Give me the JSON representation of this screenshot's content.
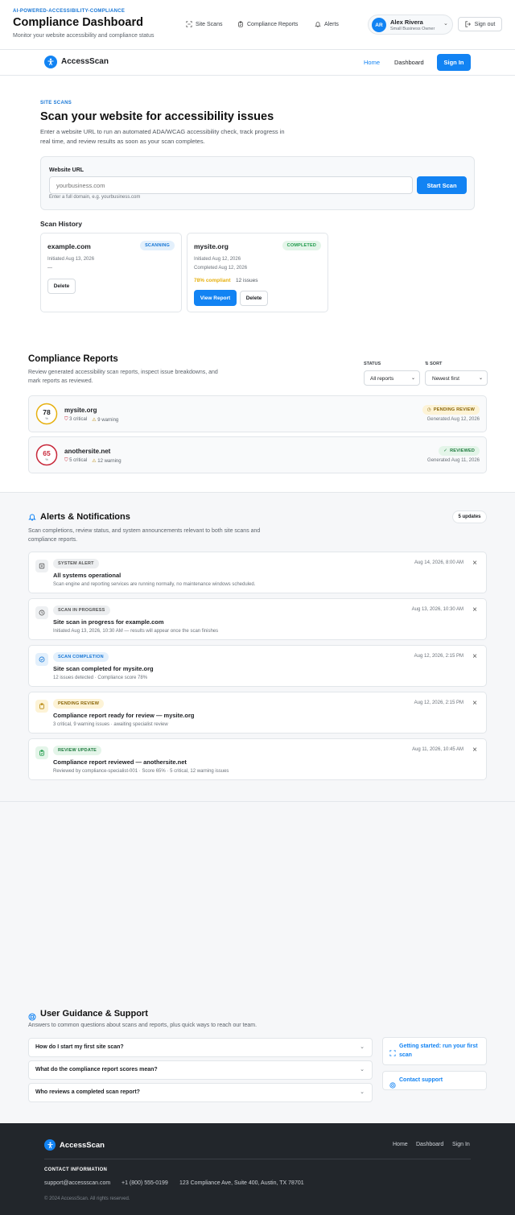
{
  "header": {
    "eyebrow": "AI-POWERED-ACCESSIBILITY-COMPLIANCE",
    "title": "Compliance Dashboard",
    "subtitle": "Monitor your website accessibility and compliance status",
    "tabs": [
      {
        "label": "Site Scans",
        "icon": "scan-icon"
      },
      {
        "label": "Compliance Reports",
        "icon": "clipboard-icon"
      },
      {
        "label": "Alerts",
        "icon": "bell-icon"
      }
    ],
    "user": {
      "initials": "AR",
      "name": "Alex Rivera",
      "role": "Small Business Owner"
    },
    "signout": "Sign out"
  },
  "sitenav": {
    "brand": "AccessScan",
    "links": [
      "Home",
      "Dashboard"
    ],
    "signin": "Sign In"
  },
  "scan": {
    "eyebrow": "SITE SCANS",
    "title": "Scan your website for accessibility issues",
    "desc": "Enter a website URL to run an automated ADA/WCAG accessibility check, track progress in real time, and review results as soon as your scan completes.",
    "url_label": "Website URL",
    "url_placeholder": "yourbusiness.com",
    "url_hint": "Enter a full domain, e.g. yourbusiness.com",
    "start_button": "Start Scan",
    "history_title": "Scan History",
    "history": [
      {
        "domain": "example.com",
        "status": "SCANNING",
        "initiated": "Initiated Aug 13, 2026",
        "extra": "—",
        "delete": "Delete"
      },
      {
        "domain": "mysite.org",
        "status": "COMPLETED",
        "initiated": "Initiated Aug 12, 2026",
        "completed": "Completed Aug 12, 2026",
        "compliant": "78% compliant",
        "issues": "12 issues",
        "view": "View Report",
        "delete": "Delete"
      }
    ]
  },
  "reports": {
    "title": "Compliance Reports",
    "desc": "Review generated accessibility scan reports, inspect issue breakdowns, and mark reports as reviewed.",
    "status_label": "STATUS",
    "sort_label": "SORT",
    "status_value": "All reports",
    "sort_value": "Newest first",
    "items": [
      {
        "score": "78",
        "unit": "%",
        "domain": "mysite.org",
        "critical": "3 critical",
        "warning": "9 warning",
        "badge": "PENDING REVIEW",
        "generated": "Generated Aug 12, 2026",
        "ring_color": "#e6b00f",
        "score_fraction": 0.78
      },
      {
        "score": "65",
        "unit": "%",
        "domain": "anothersite.net",
        "critical": "5 critical",
        "warning": "12 warning",
        "badge": "REVIEWED",
        "generated": "Generated Aug 11, 2026",
        "ring_color": "#c8283a",
        "score_fraction": 0.65
      }
    ]
  },
  "alerts": {
    "title": "Alerts & Notifications",
    "desc": "Scan completions, review status, and system announcements relevant to both site scans and compliance reports.",
    "count": "5 updates",
    "items": [
      {
        "tag": "SYSTEM ALERT",
        "title": "All systems operational",
        "sub": "Scan engine and reporting services are running normally, no maintenance windows scheduled.",
        "time": "Aug 14, 2026, 8:00 AM",
        "icon": "server-icon"
      },
      {
        "tag": "SCAN IN PROGRESS",
        "title": "Site scan in progress for example.com",
        "sub": "Initiated Aug 13, 2026, 10:30 AM — results will appear once the scan finishes",
        "time": "Aug 13, 2026, 10:30 AM",
        "icon": "clock-icon"
      },
      {
        "tag": "SCAN COMPLETION",
        "title": "Site scan completed for mysite.org",
        "sub": "12 issues detected · Compliance score 78%",
        "time": "Aug 12, 2026, 2:15 PM",
        "icon": "check-circle-icon"
      },
      {
        "tag": "PENDING REVIEW",
        "title": "Compliance report ready for review — mysite.org",
        "sub": "3 critical, 9 warning issues · awaiting specialist review",
        "time": "Aug 12, 2026, 2:15 PM",
        "icon": "clipboard-icon"
      },
      {
        "tag": "REVIEW UPDATE",
        "title": "Compliance report reviewed — anothersite.net",
        "sub": "Reviewed by compliance-specialist-001 · Score 65% · 5 critical, 12 warning issues",
        "time": "Aug 11, 2026, 10:45 AM",
        "icon": "clipboard-check-icon"
      }
    ]
  },
  "guide": {
    "title": "User Guidance & Support",
    "desc": "Answers to common questions about scans and reports, plus quick ways to reach our team.",
    "faqs": [
      "How do I start my first site scan?",
      "What do the compliance report scores mean?",
      "Who reviews a completed scan report?"
    ],
    "getting_started": "Getting started: run your first scan",
    "contact": "Contact support"
  },
  "footer": {
    "brand": "AccessScan",
    "links": [
      "Home",
      "Dashboard",
      "Sign In"
    ],
    "contact_title": "CONTACT INFORMATION",
    "email": "support@accessscan.com",
    "phone": "+1 (800) 555-0199",
    "address": "123 Compliance Ave, Suite 400, Austin, TX 78701",
    "copyright": "© 2024 AccessScan. All rights reserved."
  },
  "colors": {
    "accent": "#1283f3",
    "footer_bg": "#22262b",
    "scanning": "#1877d6",
    "completed": "#1e9a4a",
    "pending": "#b7860b",
    "critical": "#c8283a"
  }
}
